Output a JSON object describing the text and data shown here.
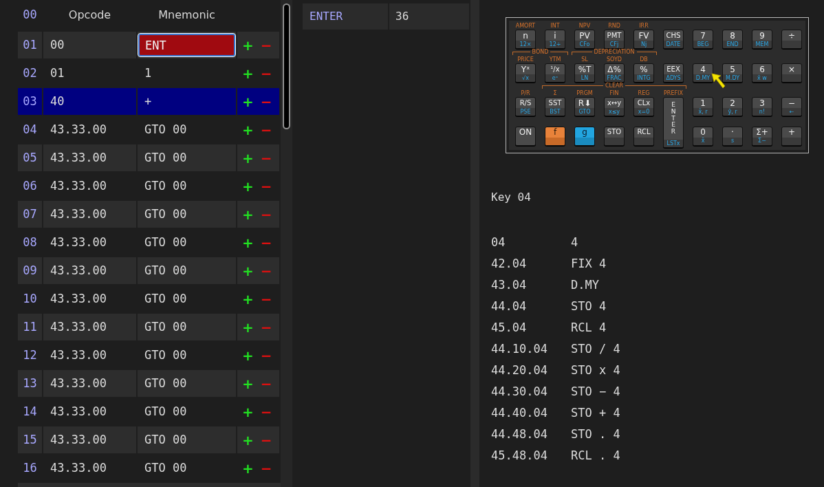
{
  "program_table": {
    "header": {
      "index": "00",
      "opcode": "Opcode",
      "mnemonic": "Mnemonic"
    },
    "rows": [
      {
        "index": "01",
        "opcode": "00",
        "mnemonic": "ENT",
        "selected": false,
        "editing": true,
        "add": "+",
        "remove": "−"
      },
      {
        "index": "02",
        "opcode": "01",
        "mnemonic": "1",
        "selected": false,
        "editing": false,
        "add": "+",
        "remove": "−"
      },
      {
        "index": "03",
        "opcode": "40",
        "mnemonic": "+",
        "selected": true,
        "editing": false,
        "add": "+",
        "remove": "−"
      },
      {
        "index": "04",
        "opcode": "43.33.00",
        "mnemonic": "GTO 00",
        "selected": false,
        "editing": false,
        "add": "+",
        "remove": "−"
      },
      {
        "index": "05",
        "opcode": "43.33.00",
        "mnemonic": "GTO 00",
        "selected": false,
        "editing": false,
        "add": "+",
        "remove": "−"
      },
      {
        "index": "06",
        "opcode": "43.33.00",
        "mnemonic": "GTO 00",
        "selected": false,
        "editing": false,
        "add": "+",
        "remove": "−"
      },
      {
        "index": "07",
        "opcode": "43.33.00",
        "mnemonic": "GTO 00",
        "selected": false,
        "editing": false,
        "add": "+",
        "remove": "−"
      },
      {
        "index": "08",
        "opcode": "43.33.00",
        "mnemonic": "GTO 00",
        "selected": false,
        "editing": false,
        "add": "+",
        "remove": "−"
      },
      {
        "index": "09",
        "opcode": "43.33.00",
        "mnemonic": "GTO 00",
        "selected": false,
        "editing": false,
        "add": "+",
        "remove": "−"
      },
      {
        "index": "10",
        "opcode": "43.33.00",
        "mnemonic": "GTO 00",
        "selected": false,
        "editing": false,
        "add": "+",
        "remove": "−"
      },
      {
        "index": "11",
        "opcode": "43.33.00",
        "mnemonic": "GTO 00",
        "selected": false,
        "editing": false,
        "add": "+",
        "remove": "−"
      },
      {
        "index": "12",
        "opcode": "43.33.00",
        "mnemonic": "GTO 00",
        "selected": false,
        "editing": false,
        "add": "+",
        "remove": "−"
      },
      {
        "index": "13",
        "opcode": "43.33.00",
        "mnemonic": "GTO 00",
        "selected": false,
        "editing": false,
        "add": "+",
        "remove": "−"
      },
      {
        "index": "14",
        "opcode": "43.33.00",
        "mnemonic": "GTO 00",
        "selected": false,
        "editing": false,
        "add": "+",
        "remove": "−"
      },
      {
        "index": "15",
        "opcode": "43.33.00",
        "mnemonic": "GTO 00",
        "selected": false,
        "editing": false,
        "add": "+",
        "remove": "−"
      },
      {
        "index": "16",
        "opcode": "43.33.00",
        "mnemonic": "GTO 00",
        "selected": false,
        "editing": false,
        "add": "+",
        "remove": "−"
      }
    ]
  },
  "key_lookup": [
    {
      "name": "ENTER",
      "code": "36"
    }
  ],
  "calculator": {
    "key_rows": [
      [
        {
          "kind": "normal",
          "top": "AMORT",
          "main": "n",
          "bottom": "12×"
        },
        {
          "kind": "normal",
          "top": "INT",
          "main": "i",
          "bottom": "12÷"
        },
        {
          "kind": "normal",
          "top": "NPV",
          "main": "PV",
          "bottom": "CFo"
        },
        {
          "kind": "normal",
          "top": "RND",
          "main": "PMT",
          "bottom": "CFj"
        },
        {
          "kind": "normal",
          "top": "IRR",
          "main": "FV",
          "bottom": "Nj"
        },
        {
          "kind": "normal",
          "main": "CHS",
          "bottom": "DATE"
        },
        {
          "kind": "normal",
          "main": "7",
          "bottom": "BEG"
        },
        {
          "kind": "normal",
          "main": "8",
          "bottom": "END"
        },
        {
          "kind": "normal",
          "main": "9",
          "bottom": "MEM"
        },
        {
          "kind": "normal",
          "main": "÷"
        }
      ],
      [
        {
          "kind": "normal",
          "top": "PRICE",
          "main": "Yˣ",
          "bottom": "√x"
        },
        {
          "kind": "normal",
          "top": "YTM",
          "main": "¹/x",
          "bottom": "eˣ"
        },
        {
          "kind": "normal",
          "top": "SL",
          "main": "%T",
          "bottom": "LN"
        },
        {
          "kind": "normal",
          "top": "SOYD",
          "main": "Δ%",
          "bottom": "FRAC"
        },
        {
          "kind": "normal",
          "top": "DB",
          "main": "%",
          "bottom": "INTG"
        },
        {
          "kind": "normal",
          "main": "EEX",
          "bottom": "ΔDYS"
        },
        {
          "kind": "normal",
          "main": "4",
          "bottom": "D.MY"
        },
        {
          "kind": "normal",
          "main": "5",
          "bottom": "M.DY"
        },
        {
          "kind": "normal",
          "main": "6",
          "bottom": "x̄ w"
        },
        {
          "kind": "normal",
          "main": "×"
        }
      ],
      [
        {
          "kind": "normal",
          "top": "P/R",
          "main": "R/S",
          "bottom": "PSE"
        },
        {
          "kind": "normal",
          "top": "Σ",
          "main": "SST",
          "bottom": "BST"
        },
        {
          "kind": "normal",
          "top": "PRGM",
          "main": "R⬇",
          "bottom": "GTO"
        },
        {
          "kind": "normal",
          "top": "FIN",
          "main": "x↔y",
          "bottom": "x≤y"
        },
        {
          "kind": "normal",
          "top": "REG",
          "main": "CLx",
          "bottom": "x=0"
        },
        {
          "kind": "tall",
          "top": "PREFIX",
          "main": "ENTER",
          "bottom": "LSTx"
        },
        {
          "kind": "normal",
          "main": "1",
          "bottom": "x̂, r"
        },
        {
          "kind": "normal",
          "main": "2",
          "bottom": "ŷ, r"
        },
        {
          "kind": "normal",
          "main": "3",
          "bottom": "n!"
        },
        {
          "kind": "normal",
          "main": "−",
          "bottom": "←"
        }
      ],
      [
        {
          "kind": "plain",
          "main": "ON"
        },
        {
          "kind": "f",
          "main": "f"
        },
        {
          "kind": "g",
          "main": "g"
        },
        {
          "kind": "normal",
          "main": "STO"
        },
        {
          "kind": "normal",
          "main": "RCL"
        },
        {
          "kind": "normal",
          "main": "0",
          "bottom": "x̄"
        },
        {
          "kind": "normal",
          "main": "·",
          "bottom": "s"
        },
        {
          "kind": "normal",
          "main": "Σ+",
          "bottom": "Σ−"
        },
        {
          "kind": "normal",
          "main": "+"
        }
      ]
    ],
    "bracket_rows": [
      [
        "BOND",
        "DEPRECIATION"
      ],
      [
        "CLEAR"
      ]
    ]
  },
  "key_info": {
    "title": "Key 04",
    "entries": [
      {
        "code": "04",
        "mnemonic": "4"
      },
      {
        "code": "42.04",
        "mnemonic": "FIX 4"
      },
      {
        "code": "43.04",
        "mnemonic": "D.MY"
      },
      {
        "code": "44.04",
        "mnemonic": "STO 4"
      },
      {
        "code": "45.04",
        "mnemonic": "RCL 4"
      },
      {
        "code": "44.10.04",
        "mnemonic": "STO / 4"
      },
      {
        "code": "44.20.04",
        "mnemonic": "STO x 4"
      },
      {
        "code": "44.30.04",
        "mnemonic": "STO − 4"
      },
      {
        "code": "44.40.04",
        "mnemonic": "STO + 4"
      },
      {
        "code": "44.48.04",
        "mnemonic": "STO . 4"
      },
      {
        "code": "45.48.04",
        "mnemonic": "RCL . 4"
      }
    ]
  }
}
